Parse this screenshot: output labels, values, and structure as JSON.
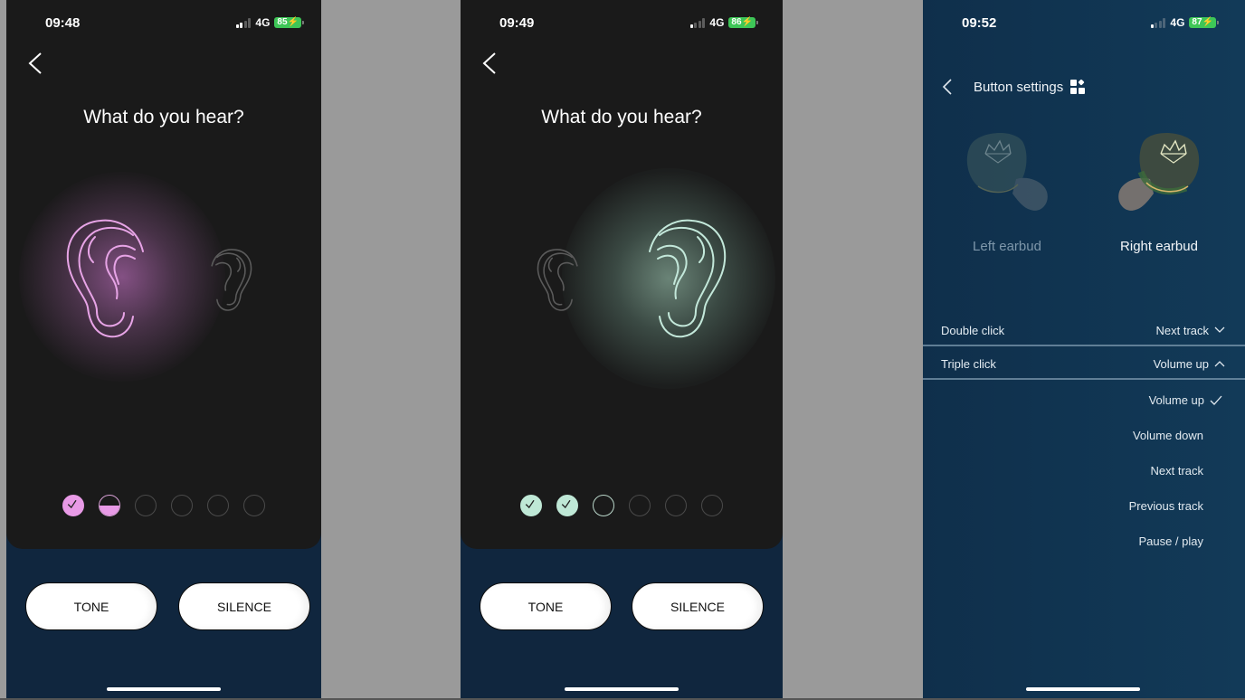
{
  "screens": [
    {
      "status": {
        "time": "09:48",
        "network": "4G",
        "battery": "85",
        "signal_bars_active": 2
      },
      "title": "What do you hear?",
      "active_ear": "left",
      "accent_color": "#e89ae6",
      "progress": {
        "total_steps": 6,
        "steps": [
          "done",
          "half",
          "empty",
          "empty",
          "empty",
          "empty"
        ]
      },
      "buttons": {
        "tone": "TONE",
        "silence": "SILENCE"
      }
    },
    {
      "status": {
        "time": "09:49",
        "network": "4G",
        "battery": "86",
        "signal_bars_active": 1
      },
      "title": "What do you hear?",
      "active_ear": "right",
      "accent_color": "#bfe8d6",
      "progress": {
        "total_steps": 6,
        "steps": [
          "done",
          "done",
          "current",
          "empty",
          "empty",
          "empty"
        ]
      },
      "buttons": {
        "tone": "TONE",
        "silence": "SILENCE"
      }
    },
    {
      "status": {
        "time": "09:52",
        "network": "4G",
        "battery": "87",
        "signal_bars_active": 1
      },
      "header": {
        "title": "Button settings",
        "icon": "widgets-icon"
      },
      "earbuds": [
        {
          "label": "Left earbud",
          "selected": false
        },
        {
          "label": "Right earbud",
          "selected": true
        }
      ],
      "settings": [
        {
          "label": "Double click",
          "value": "Next track",
          "expanded": false
        },
        {
          "label": "Triple click",
          "value": "Volume up",
          "expanded": true
        }
      ],
      "dropdown_options": [
        {
          "label": "Volume up",
          "selected": true
        },
        {
          "label": "Volume down",
          "selected": false
        },
        {
          "label": "Next track",
          "selected": false
        },
        {
          "label": "Previous track",
          "selected": false
        },
        {
          "label": "Pause / play",
          "selected": false
        }
      ]
    }
  ]
}
